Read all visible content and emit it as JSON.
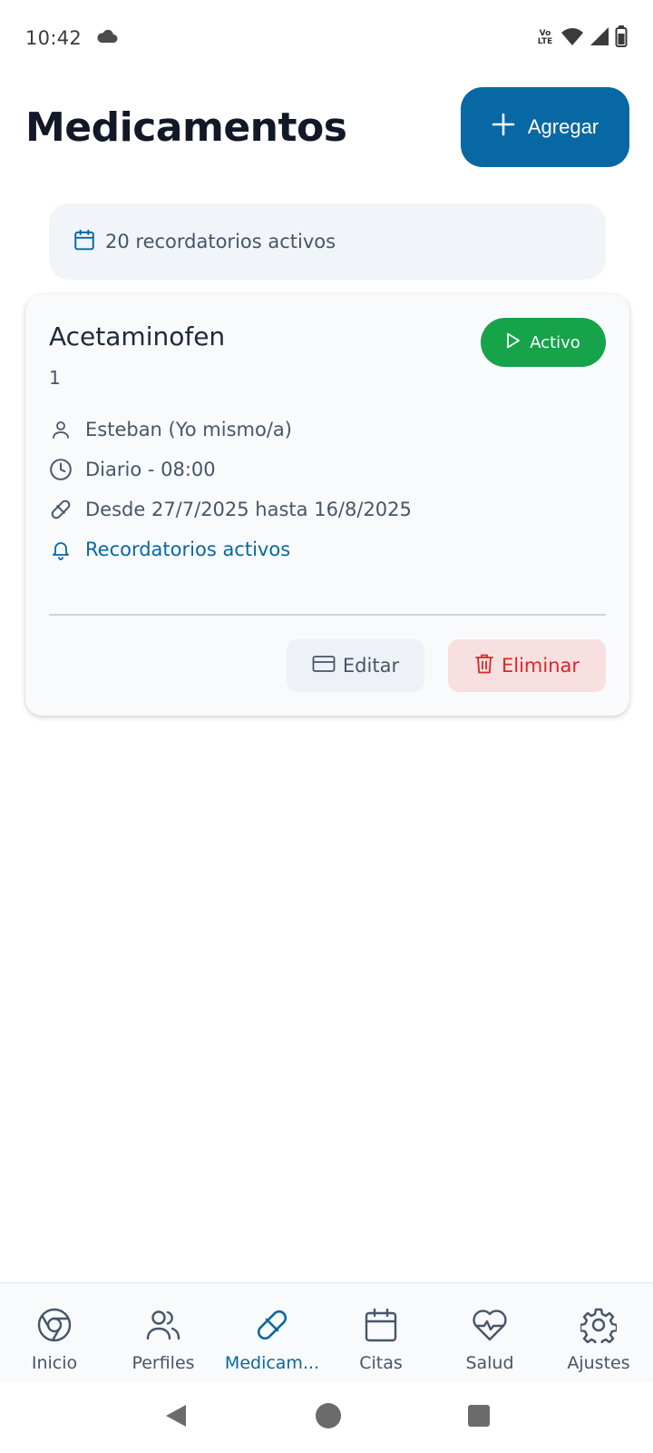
{
  "status_bar": {
    "time": "10:42",
    "volte_top": "Vo",
    "volte_bottom": "LTE",
    "icons": [
      "cloud-icon",
      "wifi-icon",
      "signal-icon",
      "battery-icon"
    ]
  },
  "header": {
    "title": "Medicamentos",
    "add_label": "Agregar"
  },
  "reminders_banner": {
    "text": "20 recordatorios activos"
  },
  "medication": {
    "name": "Acetaminofen",
    "dose": "1",
    "status": "Activo",
    "profile": "Esteban (Yo mismo/a)",
    "schedule": "Diario - 08:00",
    "dates": "Desde 27/7/2025 hasta 16/8/2025",
    "reminders": "Recordatorios activos",
    "edit_label": "Editar",
    "delete_label": "Eliminar"
  },
  "nav": {
    "items": [
      {
        "label": "Inicio",
        "icon": "home-icon"
      },
      {
        "label": "Perfiles",
        "icon": "users-icon"
      },
      {
        "label": "Medicam...",
        "icon": "pill-icon",
        "active": true
      },
      {
        "label": "Citas",
        "icon": "calendar-icon"
      },
      {
        "label": "Salud",
        "icon": "heart-pulse-icon"
      },
      {
        "label": "Ajustes",
        "icon": "gear-icon"
      }
    ]
  },
  "colors": {
    "primary": "#0768a3",
    "active_green": "#16a34a",
    "danger": "#dc2626"
  }
}
